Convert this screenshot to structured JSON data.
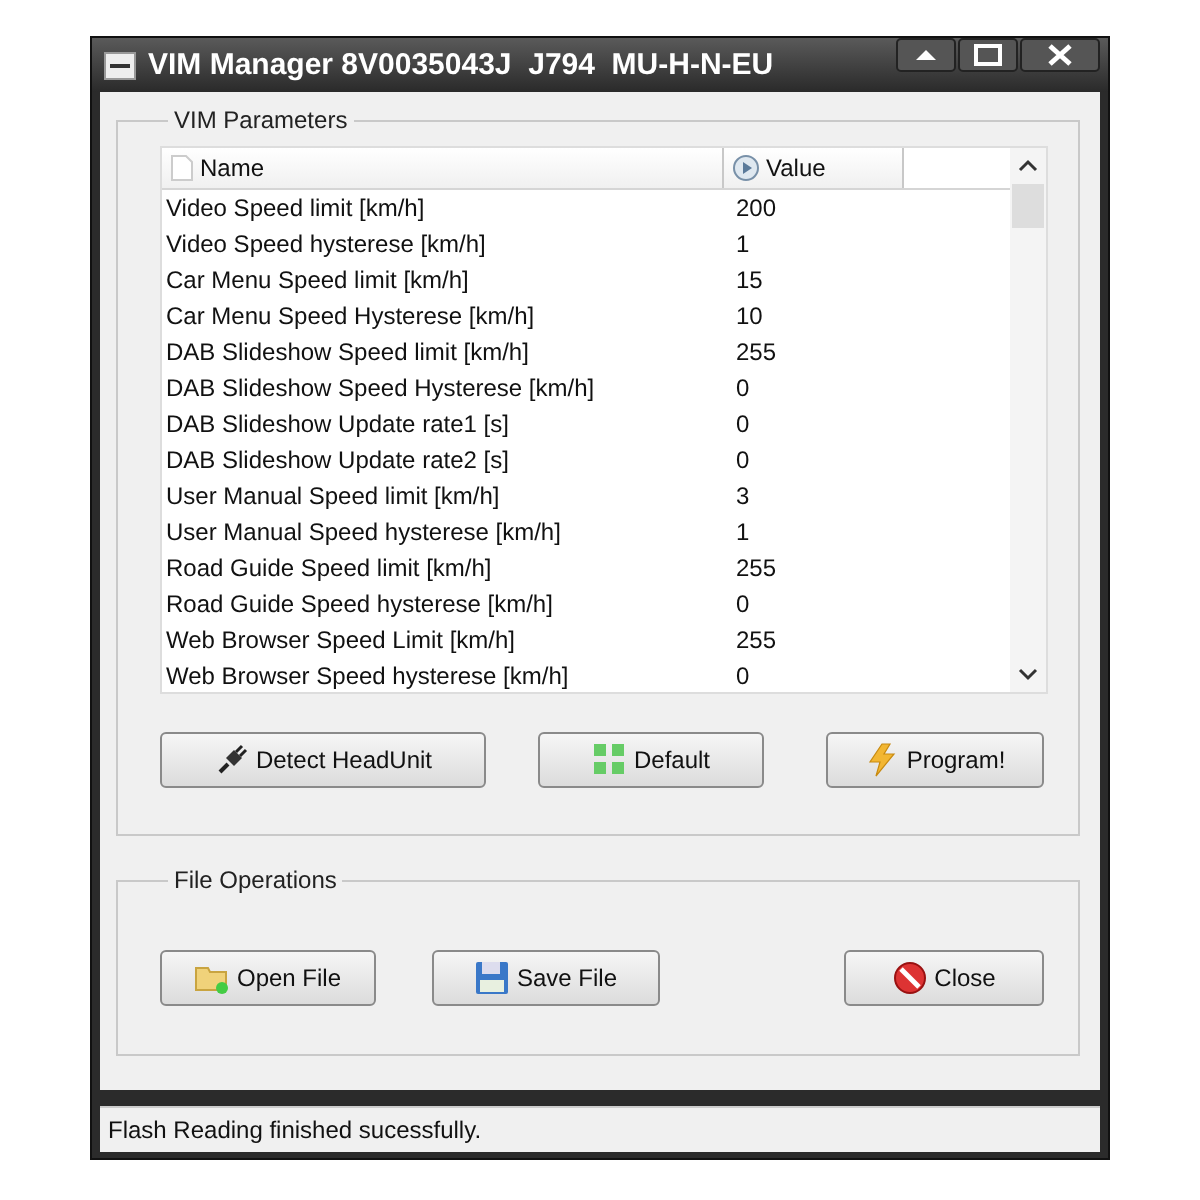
{
  "window": {
    "title": "VIM Manager 8V0035043J  J794  MU-H-N-EU"
  },
  "parameters": {
    "title": "VIM Parameters",
    "columns": [
      "Name",
      "Value"
    ],
    "rows": [
      {
        "name": "Video Speed limit [km/h]",
        "value": "200"
      },
      {
        "name": "Video Speed hysterese [km/h]",
        "value": "1"
      },
      {
        "name": "Car Menu Speed limit [km/h]",
        "value": "15"
      },
      {
        "name": "Car Menu Speed Hysterese [km/h]",
        "value": "10"
      },
      {
        "name": "DAB Slideshow Speed limit [km/h]",
        "value": "255"
      },
      {
        "name": "DAB Slideshow Speed Hysterese [km/h]",
        "value": "0"
      },
      {
        "name": "DAB Slideshow Update rate1 [s]",
        "value": "0"
      },
      {
        "name": "DAB Slideshow Update rate2 [s]",
        "value": "0"
      },
      {
        "name": "User Manual Speed limit [km/h]",
        "value": "3"
      },
      {
        "name": "User Manual Speed hysterese [km/h]",
        "value": "1"
      },
      {
        "name": "Road Guide Speed limit [km/h]",
        "value": "255"
      },
      {
        "name": "Road Guide Speed hysterese [km/h]",
        "value": "0"
      },
      {
        "name": "Web Browser Speed Limit [km/h]",
        "value": "255"
      },
      {
        "name": "Web Browser Speed hysterese [km/h]",
        "value": "0"
      }
    ],
    "buttons": [
      "Detect HeadUnit",
      "Default",
      "Program!"
    ]
  },
  "file_operations": {
    "title": "File Operations",
    "buttons": [
      "Open File",
      "Save File",
      "Close"
    ]
  },
  "status_bar": "Flash Reading finished sucessfully."
}
